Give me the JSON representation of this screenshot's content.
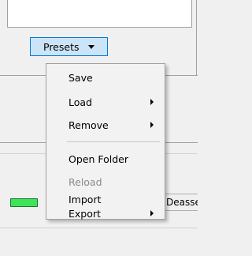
{
  "presets": {
    "label": "Presets",
    "menu": {
      "save": "Save",
      "load": "Load",
      "remove": "Remove",
      "open_folder": "Open Folder",
      "reload": "Reload",
      "import": "Import",
      "export": "Export"
    }
  },
  "background": {
    "deassert_text": "Deasse",
    "indicator_color": "#3fe35a"
  }
}
